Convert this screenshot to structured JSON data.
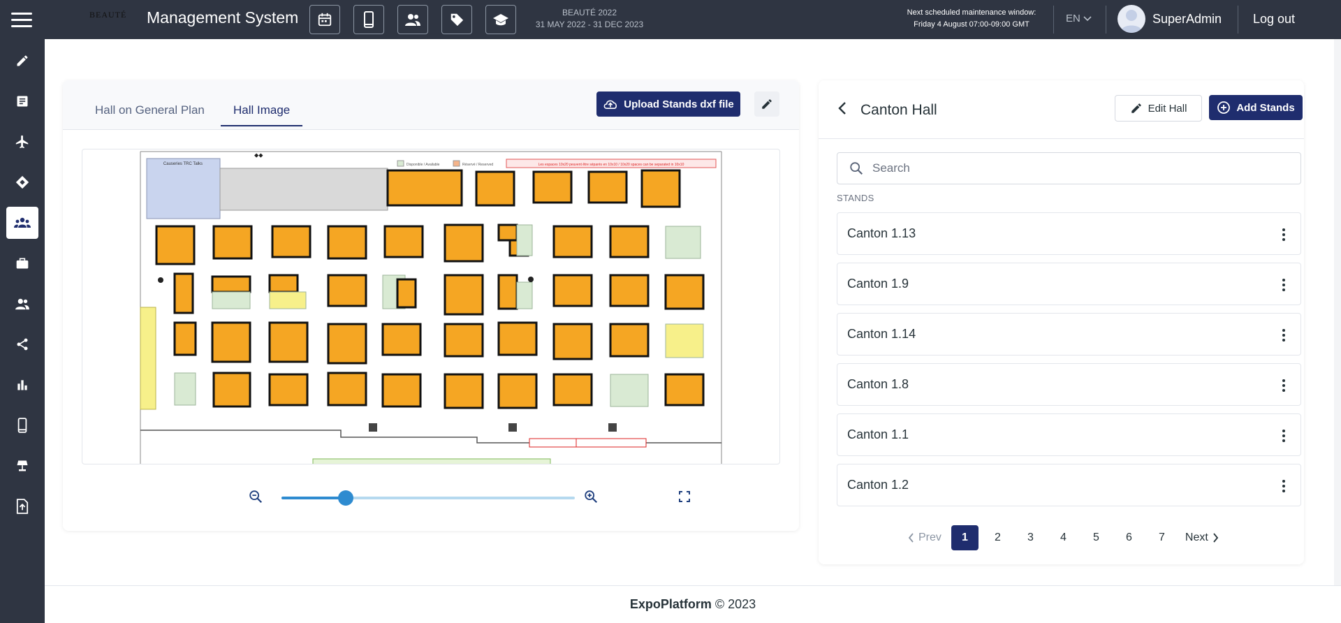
{
  "header": {
    "logo_text": "BEAUTÉ",
    "app_title": "Management System",
    "top_icons": [
      "calendar-icon",
      "mobile-icon",
      "people-icon",
      "tag-icon",
      "graduation-cap-icon"
    ],
    "event_name": "BEAUTÉ 2022",
    "event_dates": "31 MAY 2022 - 31 DEC 2023",
    "maintenance_line1": "Next scheduled maintenance window:",
    "maintenance_line2": "Friday 4 August 07:00-09:00 GMT",
    "language": "EN",
    "username": "SuperAdmin",
    "logout": "Log out"
  },
  "sidebar": {
    "items": [
      "pencil-icon",
      "list-icon",
      "plane-icon",
      "ticket-icon",
      "groups-icon",
      "briefcase-icon",
      "people-icon",
      "share-icon",
      "bar-chart-icon",
      "mobile-icon",
      "lamp-icon",
      "upload-file-icon"
    ],
    "active_index": 4
  },
  "left_card": {
    "tabs": [
      {
        "label": "Hall on General Plan"
      },
      {
        "label": "Hall Image"
      }
    ],
    "active_tab": 1,
    "upload_label": "Upload Stands dxf file",
    "floorplan": {
      "box_label": "Causeries TRC Talks",
      "legend_available": "Disponible / Available",
      "legend_reserved": "Réservé / Reserved",
      "notice": "Les espaces 10x20 peuvent être séparés en 10x10 / 10x20 spaces can be separated in 10x10"
    },
    "zoom": {
      "value": 0.22
    }
  },
  "right_card": {
    "title": "Canton Hall",
    "edit_label": "Edit Hall",
    "add_label": "Add Stands",
    "search_placeholder": "Search",
    "stands_label": "STANDS",
    "stands": [
      {
        "name": "Canton 1.13"
      },
      {
        "name": "Canton 1.9"
      },
      {
        "name": "Canton 1.14"
      },
      {
        "name": "Canton 1.8"
      },
      {
        "name": "Canton 1.1"
      },
      {
        "name": "Canton 1.2"
      }
    ],
    "pagination": {
      "prev": "Prev",
      "next": "Next",
      "pages": [
        "1",
        "2",
        "3",
        "4",
        "5",
        "6",
        "7"
      ],
      "current": "1"
    }
  },
  "footer": {
    "brand": "ExpoPlatform",
    "copyright": "© 2023"
  },
  "colors": {
    "topbar": "#2f3542",
    "primary": "#1f2d6e",
    "stand_orange": "#f5a623",
    "stand_green": "#d9ead3",
    "stand_yellow": "#f7f08a"
  }
}
